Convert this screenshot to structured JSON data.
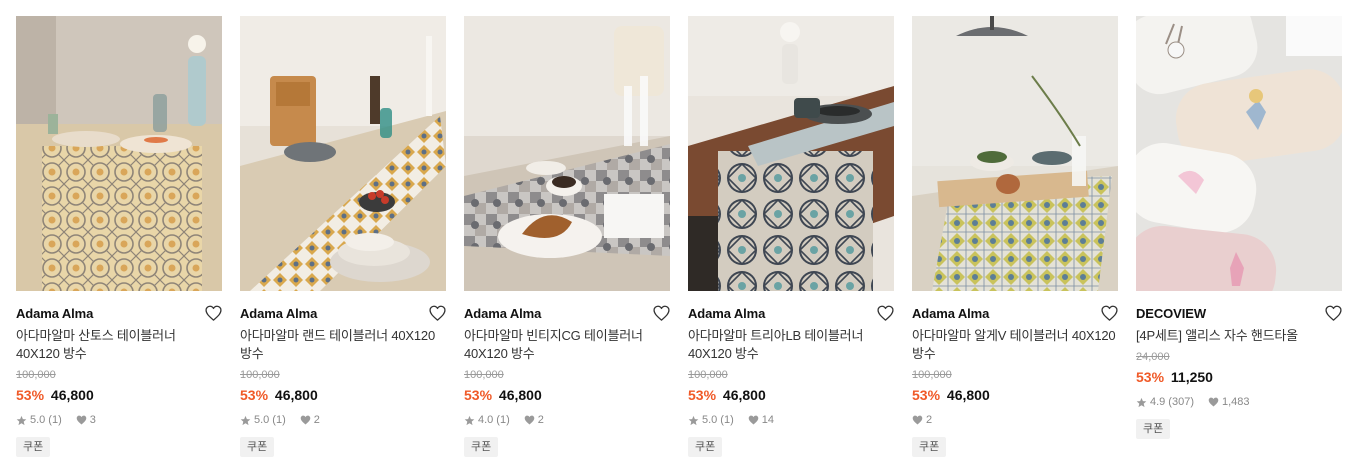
{
  "products": [
    {
      "brand": "Adama Alma",
      "title": "아다마알마 산토스 테이블러너 40X120 방수",
      "original_price": "100,000",
      "discount": "53%",
      "price": "46,800",
      "rating": "5.0",
      "review_count": "(1)",
      "likes": "3",
      "coupon": "쿠폰",
      "image_icon": "table-runner-photo"
    },
    {
      "brand": "Adama Alma",
      "title": "아다마알마 랜드 테이블러너 40X120 방수",
      "original_price": "100,000",
      "discount": "53%",
      "price": "46,800",
      "rating": "5.0",
      "review_count": "(1)",
      "likes": "2",
      "coupon": "쿠폰",
      "image_icon": "table-runner-photo"
    },
    {
      "brand": "Adama Alma",
      "title": "아다마알마 빈티지CG 테이블러너 40X120 방수",
      "original_price": "100,000",
      "discount": "53%",
      "price": "46,800",
      "rating": "4.0",
      "review_count": "(1)",
      "likes": "2",
      "coupon": "쿠폰",
      "image_icon": "table-runner-photo"
    },
    {
      "brand": "Adama Alma",
      "title": "아다마알마 트리아LB 테이블러너 40X120 방수",
      "original_price": "100,000",
      "discount": "53%",
      "price": "46,800",
      "rating": "5.0",
      "review_count": "(1)",
      "likes": "14",
      "coupon": "쿠폰",
      "image_icon": "table-runner-photo"
    },
    {
      "brand": "Adama Alma",
      "title": "아다마알마 알게V 테이블러너 40X120 방수",
      "original_price": "100,000",
      "discount": "53%",
      "price": "46,800",
      "rating": null,
      "review_count": null,
      "likes": "2",
      "coupon": "쿠폰",
      "image_icon": "table-runner-photo"
    },
    {
      "brand": "DECOVIEW",
      "title": "[4P세트] 앨리스 자수 핸드타올",
      "original_price": "24,000",
      "discount": "53%",
      "price": "11,250",
      "rating": "4.9",
      "review_count": "(307)",
      "likes": "1,483",
      "coupon": "쿠폰",
      "image_icon": "hand-towel-photo"
    }
  ],
  "colors": {
    "discount": "#f05a28",
    "strike": "#9a9a9a",
    "meta": "#888888",
    "coupon_bg": "#f1f1f1"
  }
}
